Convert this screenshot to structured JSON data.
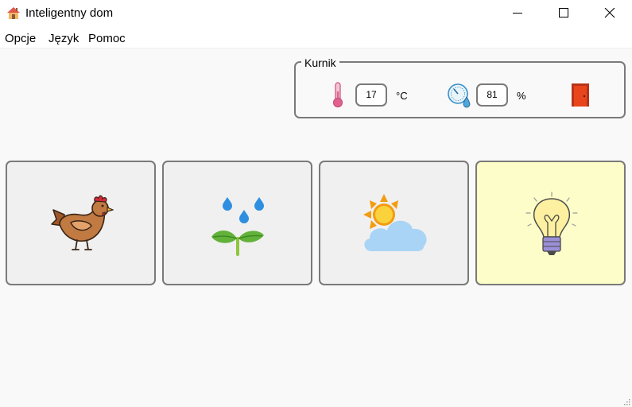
{
  "window": {
    "title": "Inteligentny dom",
    "icons": {
      "app": "house-icon",
      "minimize": "minimize-icon",
      "maximize": "maximize-icon",
      "close": "close-icon"
    }
  },
  "menu": {
    "items": [
      {
        "label": "Opcje"
      },
      {
        "label": "Język"
      },
      {
        "label": "Pomoc"
      }
    ]
  },
  "coop": {
    "title": "Kurnik",
    "temperature": {
      "value": "17",
      "unit": "°C",
      "icon": "thermometer-icon"
    },
    "humidity": {
      "value": "81",
      "unit": "%",
      "icon": "humidity-gauge-icon"
    },
    "door": {
      "icon": "door-icon",
      "color": "#e8451c"
    }
  },
  "tiles": [
    {
      "icon": "chicken-icon",
      "active": false
    },
    {
      "icon": "plant-watering-icon",
      "active": false
    },
    {
      "icon": "weather-icon",
      "active": false
    },
    {
      "icon": "light-bulb-icon",
      "active": true
    }
  ],
  "colors": {
    "tile_background": "#f0f0f0",
    "tile_active_background": "#fcfdc9",
    "border": "#7a7a7a",
    "window_background": "#f9f9f9"
  }
}
